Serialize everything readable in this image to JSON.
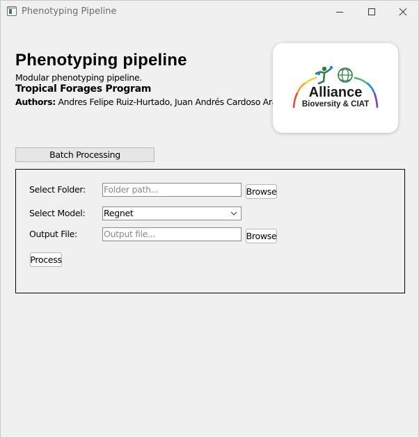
{
  "window": {
    "title": "Phenotyping Pipeline"
  },
  "header": {
    "heading": "Phenotyping pipeline",
    "subtitle": "Modular phenotyping pipeline.",
    "program": "Tropical Forages Program",
    "authors_label": "Authors:",
    "authors_names": " Andres Felipe Ruiz-Hurtado, Juan Andrés Cardoso Arango"
  },
  "logo": {
    "word": "Alliance",
    "sub": "Bioversity & CIAT",
    "arc_colors": [
      "#e94b35",
      "#f6a623",
      "#f8d12f",
      "#4bb86b",
      "#1e88e5",
      "#7b3fb5"
    ],
    "figure_color": "#2e7d46",
    "globe_color": "#2e7d46"
  },
  "toolbar": {
    "batch_label": "Batch Processing"
  },
  "form": {
    "folder_label": "Select Folder:",
    "folder_value": "",
    "folder_placeholder": "Folder path...",
    "browse_label": "Browse",
    "model_label": "Select Model:",
    "model_value": "Regnet",
    "output_label": "Output File:",
    "output_value": "",
    "output_placeholder": "Output file...",
    "browse2_label": "Browse",
    "process_label": "Process"
  }
}
